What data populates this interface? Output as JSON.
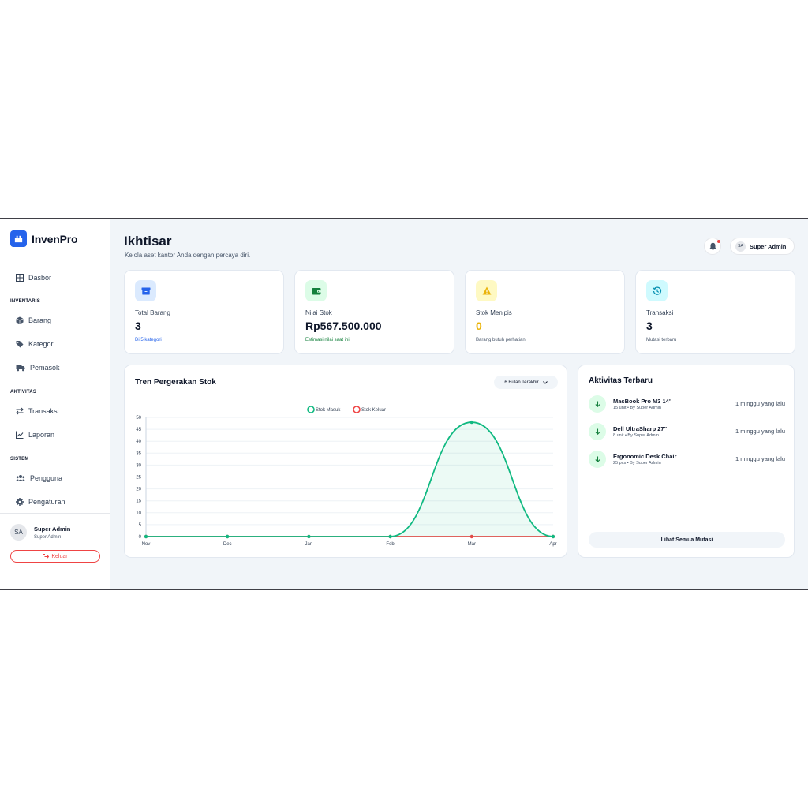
{
  "brand": {
    "name": "InvenPro"
  },
  "sidebar": {
    "dashboard": "Dasbor",
    "sections": {
      "inventory": "INVENTARIS",
      "activity": "AKTIVITAS",
      "system": "SISTEM"
    },
    "items": {
      "barang": "Barang",
      "kategori": "Kategori",
      "pemasok": "Pemasok",
      "transaksi": "Transaksi",
      "laporan": "Laporan",
      "pengguna": "Pengguna",
      "pengaturan": "Pengaturan"
    },
    "user": {
      "initials": "SA",
      "name": "Super Admin",
      "role": "Super Admin"
    },
    "logout": "Keluar"
  },
  "header": {
    "title": "Ikhtisar",
    "subtitle": "Kelola aset kantor Anda dengan percaya diri.",
    "user": {
      "initials": "SA",
      "name": "Super Admin"
    }
  },
  "stats": [
    {
      "label": "Total Barang",
      "value": "3",
      "note": "Di 5 kategori",
      "note_color": "#2563eb",
      "value_color": "#0f172a",
      "icon": "box-icon"
    },
    {
      "label": "Nilai Stok",
      "value": "Rp567.500.000",
      "note": "Estimasi nilai saat ini",
      "note_color": "#15803d",
      "value_color": "#0f172a",
      "icon": "wallet-icon"
    },
    {
      "label": "Stok Menipis",
      "value": "0",
      "note": "Barang butuh perhatian",
      "note_color": "#475569",
      "value_color": "#eab308",
      "icon": "warning-icon"
    },
    {
      "label": "Transaksi",
      "value": "3",
      "note": "Mutasi terbaru",
      "note_color": "#475569",
      "value_color": "#0f172a",
      "icon": "history-icon"
    }
  ],
  "chart": {
    "title": "Tren Pergerakan Stok",
    "range": "6 Bulan Terakhir"
  },
  "chart_data": {
    "type": "line",
    "categories": [
      "Nov",
      "Dec",
      "Jan",
      "Feb",
      "Mar",
      "Apr"
    ],
    "series": [
      {
        "name": "Stok Masuk",
        "values": [
          0,
          0,
          0,
          0,
          48,
          0
        ],
        "color": "#10b981",
        "fill": true
      },
      {
        "name": "Stok Keluar",
        "values": [
          0,
          0,
          0,
          0,
          0,
          0
        ],
        "color": "#ef4444",
        "fill": false
      }
    ],
    "yticks": [
      0,
      5,
      10,
      15,
      20,
      25,
      30,
      35,
      40,
      45,
      50
    ],
    "ylim": [
      0,
      50
    ],
    "legend": "top-center",
    "grid": true
  },
  "activity": {
    "title": "Aktivitas Terbaru",
    "items": [
      {
        "name": "MacBook Pro M3 14\"",
        "meta": "15 unit • By Super Admin",
        "time": "1 minggu yang lalu"
      },
      {
        "name": "Dell UltraSharp 27\"",
        "meta": "8 unit • By Super Admin",
        "time": "1 minggu yang lalu"
      },
      {
        "name": "Ergonomic Desk Chair",
        "meta": "25 pcs • By Super Admin",
        "time": "1 minggu yang lalu"
      }
    ],
    "view_all": "Lihat Semua Mutasi"
  }
}
